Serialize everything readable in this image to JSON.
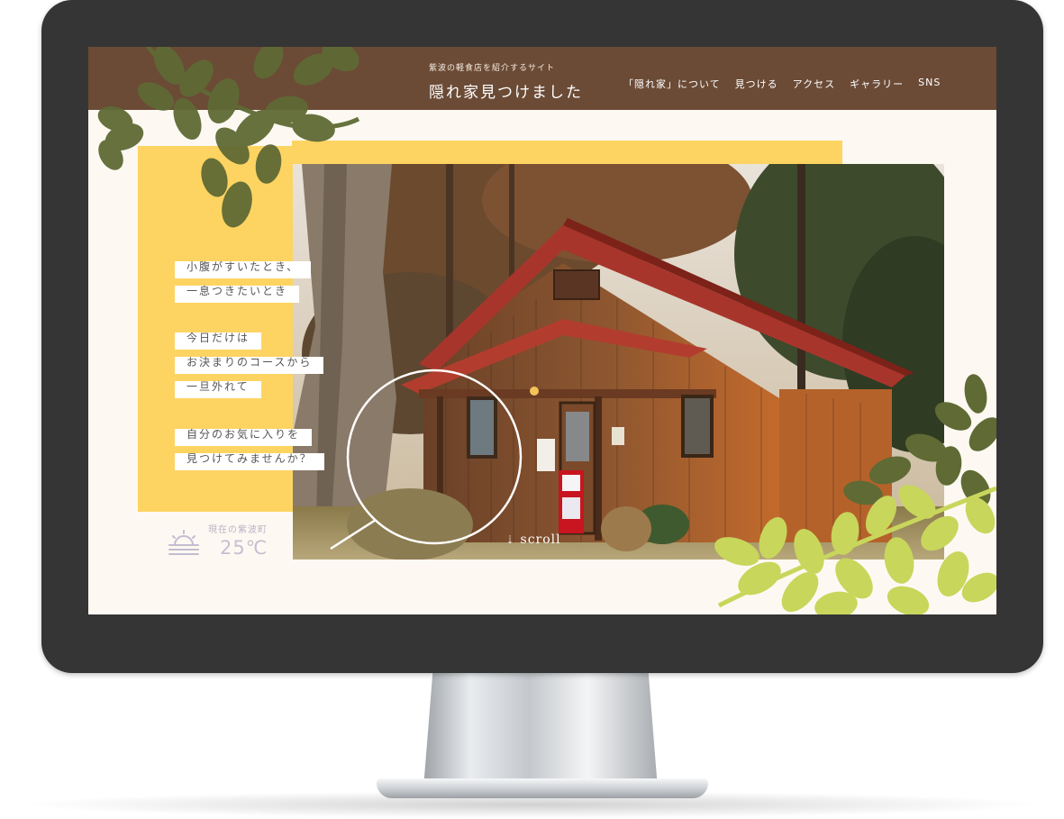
{
  "site": {
    "tagline": "紫波の軽食店を紹介するサイト",
    "title": "隠れ家見つけました"
  },
  "nav": {
    "items": [
      "「隠れ家」について",
      "見つける",
      "アクセス",
      "ギャラリー",
      "SNS"
    ]
  },
  "hero": {
    "lines": [
      "小腹がすいたとき、",
      "一息つきたいとき",
      "今日だけは",
      "お決まりのコースから",
      "一旦外れて",
      "自分のお気に入りを",
      "見つけてみませんか？"
    ],
    "scroll_label": "scroll"
  },
  "weather": {
    "label": "現在の紫波町",
    "temperature": "25℃",
    "icon": "sunrise-icon"
  },
  "colors": {
    "header_bg": "#6b4b36",
    "accent_yellow": "#fdd462",
    "screen_bg": "#fdf9f2",
    "leaf_dark": "#5f6a34",
    "leaf_light": "#c8d65c"
  }
}
